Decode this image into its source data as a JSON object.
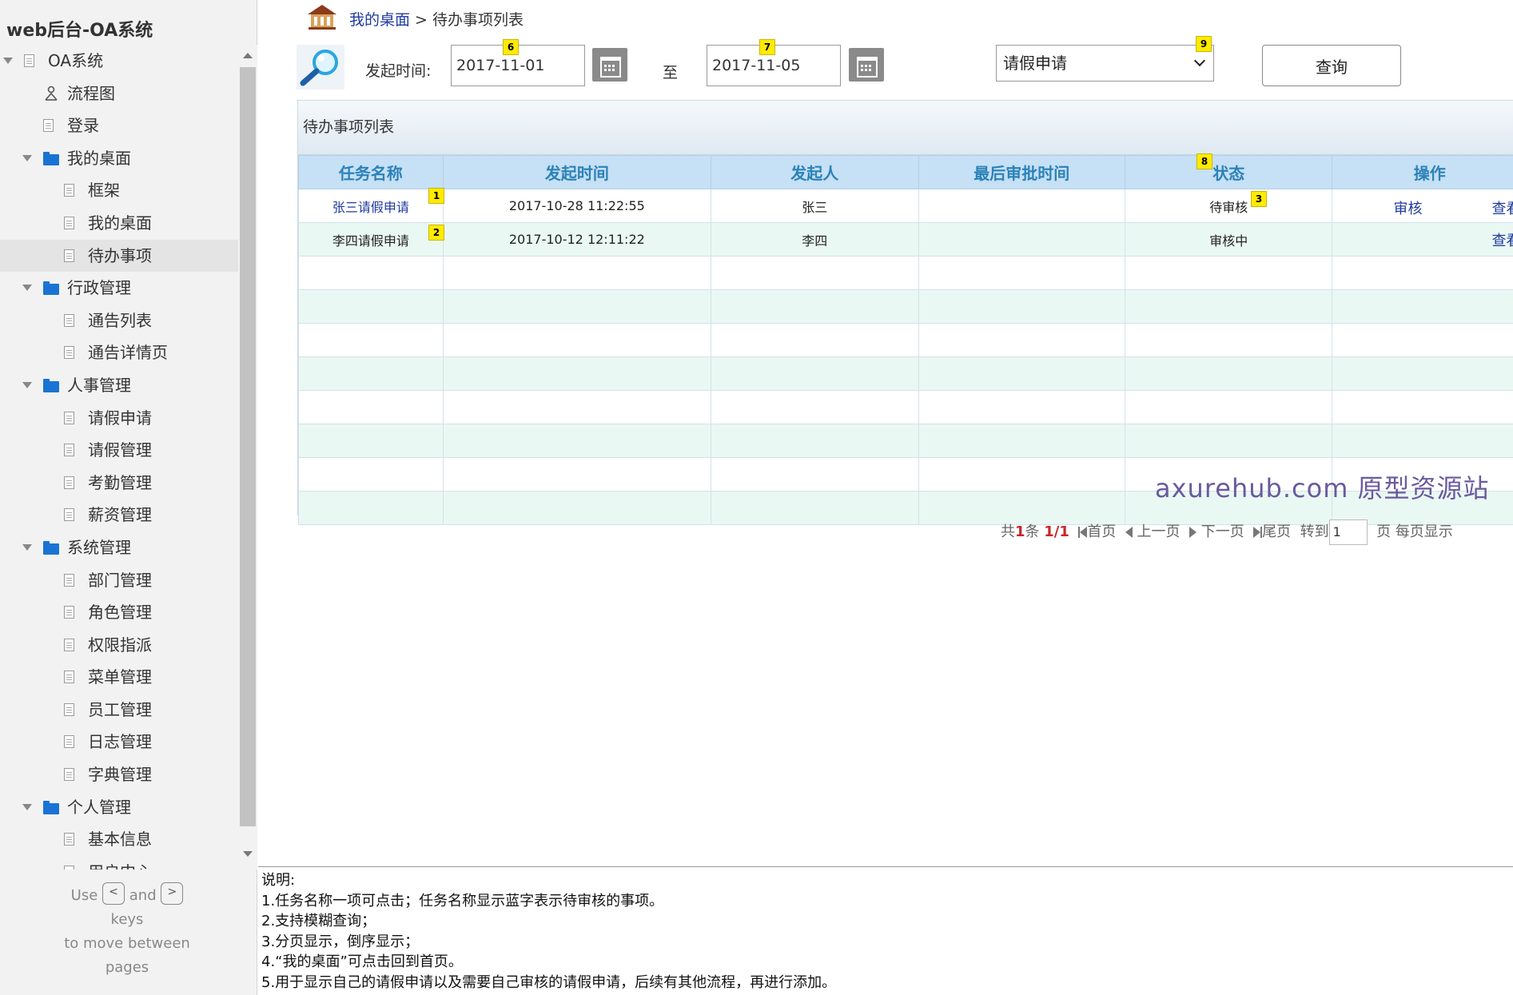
{
  "app": {
    "title": "web后台-OA系统"
  },
  "sidebar": {
    "items": [
      {
        "label": "OA系统",
        "icon": "page-icon",
        "level": 0,
        "expanded": true
      },
      {
        "label": "流程图",
        "icon": "flowchart-icon",
        "level": 1
      },
      {
        "label": "登录",
        "icon": "page-icon",
        "level": 1
      },
      {
        "label": "我的桌面",
        "icon": "folder-icon",
        "level": 1,
        "expanded": true
      },
      {
        "label": "框架",
        "icon": "page-icon",
        "level": 2
      },
      {
        "label": "我的桌面",
        "icon": "page-icon",
        "level": 2
      },
      {
        "label": "待办事项",
        "icon": "page-icon",
        "level": 2,
        "active": true
      },
      {
        "label": "行政管理",
        "icon": "folder-icon",
        "level": 1,
        "expanded": true
      },
      {
        "label": "通告列表",
        "icon": "page-icon",
        "level": 2
      },
      {
        "label": "通告详情页",
        "icon": "page-icon",
        "level": 2
      },
      {
        "label": "人事管理",
        "icon": "folder-icon",
        "level": 1,
        "expanded": true
      },
      {
        "label": "请假申请",
        "icon": "page-icon",
        "level": 2
      },
      {
        "label": "请假管理",
        "icon": "page-icon",
        "level": 2
      },
      {
        "label": "考勤管理",
        "icon": "page-icon",
        "level": 2
      },
      {
        "label": "薪资管理",
        "icon": "page-icon",
        "level": 2
      },
      {
        "label": "系统管理",
        "icon": "folder-icon",
        "level": 1,
        "expanded": true
      },
      {
        "label": "部门管理",
        "icon": "page-icon",
        "level": 2
      },
      {
        "label": "角色管理",
        "icon": "page-icon",
        "level": 2
      },
      {
        "label": "权限指派",
        "icon": "page-icon",
        "level": 2
      },
      {
        "label": "菜单管理",
        "icon": "page-icon",
        "level": 2
      },
      {
        "label": "员工管理",
        "icon": "page-icon",
        "level": 2
      },
      {
        "label": "日志管理",
        "icon": "page-icon",
        "level": 2
      },
      {
        "label": "字典管理",
        "icon": "page-icon",
        "level": 2
      },
      {
        "label": "个人管理",
        "icon": "folder-icon",
        "level": 1,
        "expanded": true
      },
      {
        "label": "基本信息",
        "icon": "page-icon",
        "level": 2
      },
      {
        "label": "用户中心",
        "icon": "page-icon",
        "level": 2
      }
    ],
    "key_hint": {
      "use": "Use",
      "prev_key": "<",
      "and": "and",
      "next_key": ">",
      "keys": "keys",
      "line2": "to move between",
      "line3": "pages"
    }
  },
  "breadcrumb": {
    "home_link": "我的桌面",
    "separator": " > ",
    "current": "待办事项列表"
  },
  "search": {
    "start_label": "发起时间:",
    "start_date": "2017-11-01",
    "to_label": "至",
    "end_date": "2017-11-05",
    "type_selected": "请假申请",
    "query_label": "查询"
  },
  "badges": {
    "b1": "1",
    "b2": "2",
    "b3": "3",
    "b6": "6",
    "b7": "7",
    "b8": "8",
    "b9": "9"
  },
  "panel": {
    "title": "待办事项列表"
  },
  "table": {
    "columns": [
      "任务名称",
      "发起时间",
      "发起人",
      "最后审批时间",
      "状态",
      "操作"
    ],
    "rows": [
      {
        "task": "张三请假申请",
        "time": "2017-10-28 11:22:55",
        "initiator": "张三",
        "last_approval": "",
        "status": "待审核",
        "action_review": "审核",
        "action_view": "查看"
      },
      {
        "task": "李四请假申请",
        "time": "2017-10-12 12:11:22",
        "initiator": "李四",
        "last_approval": "",
        "status": "审核中",
        "action_review": "",
        "action_view": "查看"
      }
    ]
  },
  "watermark": "axurehub.com 原型资源站",
  "pager": {
    "total_prefix": "共",
    "total_count": "1",
    "total_suffix": "条",
    "page_fraction": "1/1",
    "first": "首页",
    "prev": "上一页",
    "next": "下一页",
    "last": "尾页",
    "goto": "转到",
    "page_value": "1",
    "per_page": "页 每页显示"
  },
  "notes": {
    "title": "说明:",
    "lines": [
      "1.任务名称一项可点击；任务名称显示蓝字表示待审核的事项。",
      "2.支持模糊查询；",
      "3.分页显示，倒序显示；",
      "4.“我的桌面”可点击回到首页。",
      "5.用于显示自己的请假申请以及需要自己审核的请假申请，后续有其他流程，再进行添加。"
    ]
  },
  "colors": {
    "link": "#1f3a9e",
    "header_bg": "#c6e0f5",
    "header_text": "#2b82b8",
    "folder": "#1a73d4",
    "badge": "#ffea00",
    "pager_red": "#c62828"
  }
}
